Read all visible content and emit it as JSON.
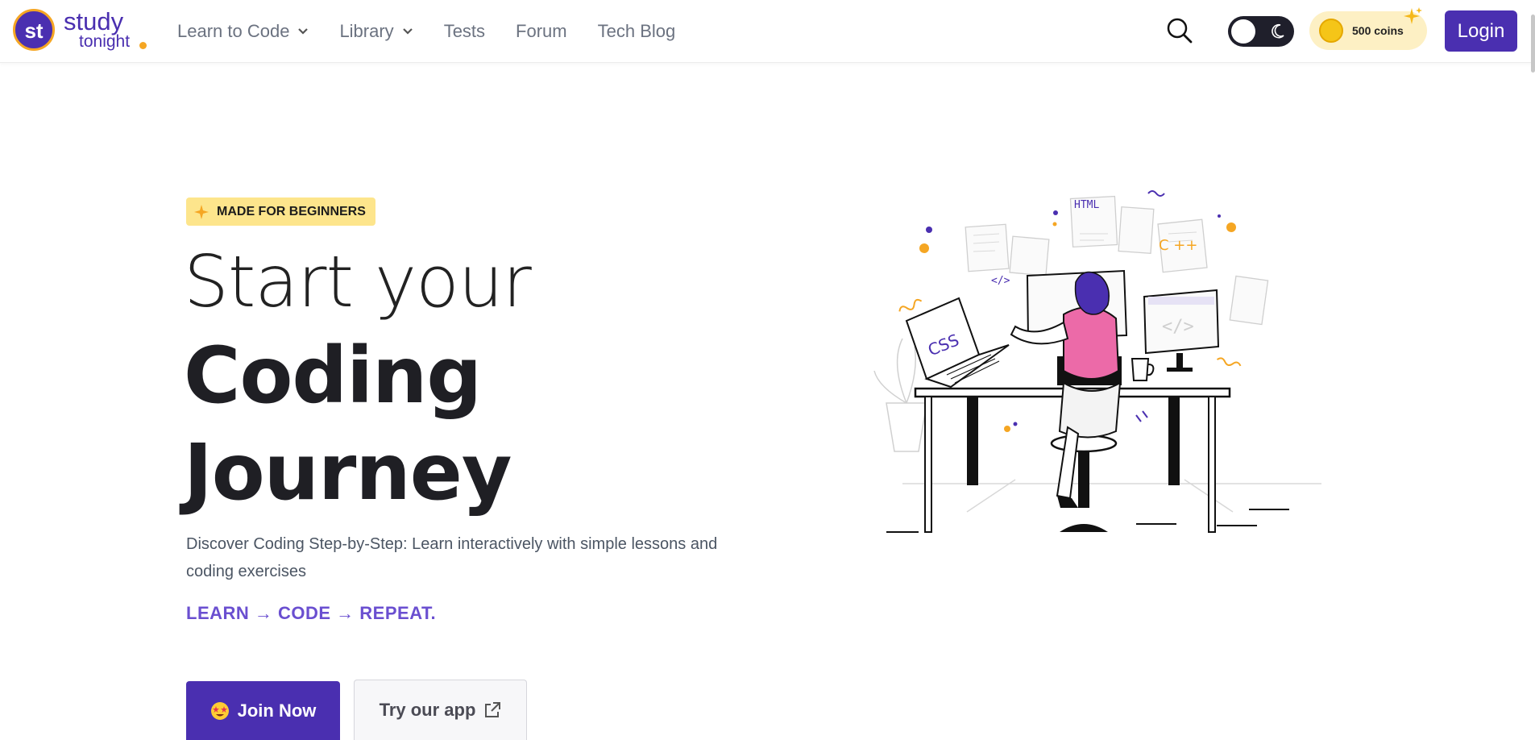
{
  "header": {
    "logo": {
      "initials": "st",
      "word1": "study",
      "word2": "tonight"
    },
    "nav": [
      {
        "label": "Learn to Code",
        "has_dropdown": true
      },
      {
        "label": "Library",
        "has_dropdown": true
      },
      {
        "label": "Tests",
        "has_dropdown": false
      },
      {
        "label": "Forum",
        "has_dropdown": false
      },
      {
        "label": "Tech Blog",
        "has_dropdown": false
      }
    ],
    "search_icon": "search-icon",
    "theme_toggle": {
      "state": "light",
      "icon": "moon-icon"
    },
    "coins_label": "500 coins",
    "login_label": "Login"
  },
  "hero": {
    "badge": "MADE FOR BEGINNERS",
    "heading_line1": "Start your",
    "heading_line2": "Coding",
    "heading_line3": "Journey",
    "description": "Discover Coding Step-by-Step: Learn interactively with simple lessons and coding exercises",
    "tagline": "LEARN → CODE → REPEAT.",
    "join_label": "Join Now",
    "app_label": "Try our app",
    "illustration_labels": {
      "html": "HTML",
      "cpp": "C ++",
      "css": "CSS",
      "tag": "</>",
      "code": "</>"
    }
  },
  "colors": {
    "brand": "#4a2fb0",
    "accent": "#f5a623",
    "badge_bg": "#fde58c",
    "tagline": "#6a4fd0",
    "coins_bg": "#fdf0c4"
  }
}
